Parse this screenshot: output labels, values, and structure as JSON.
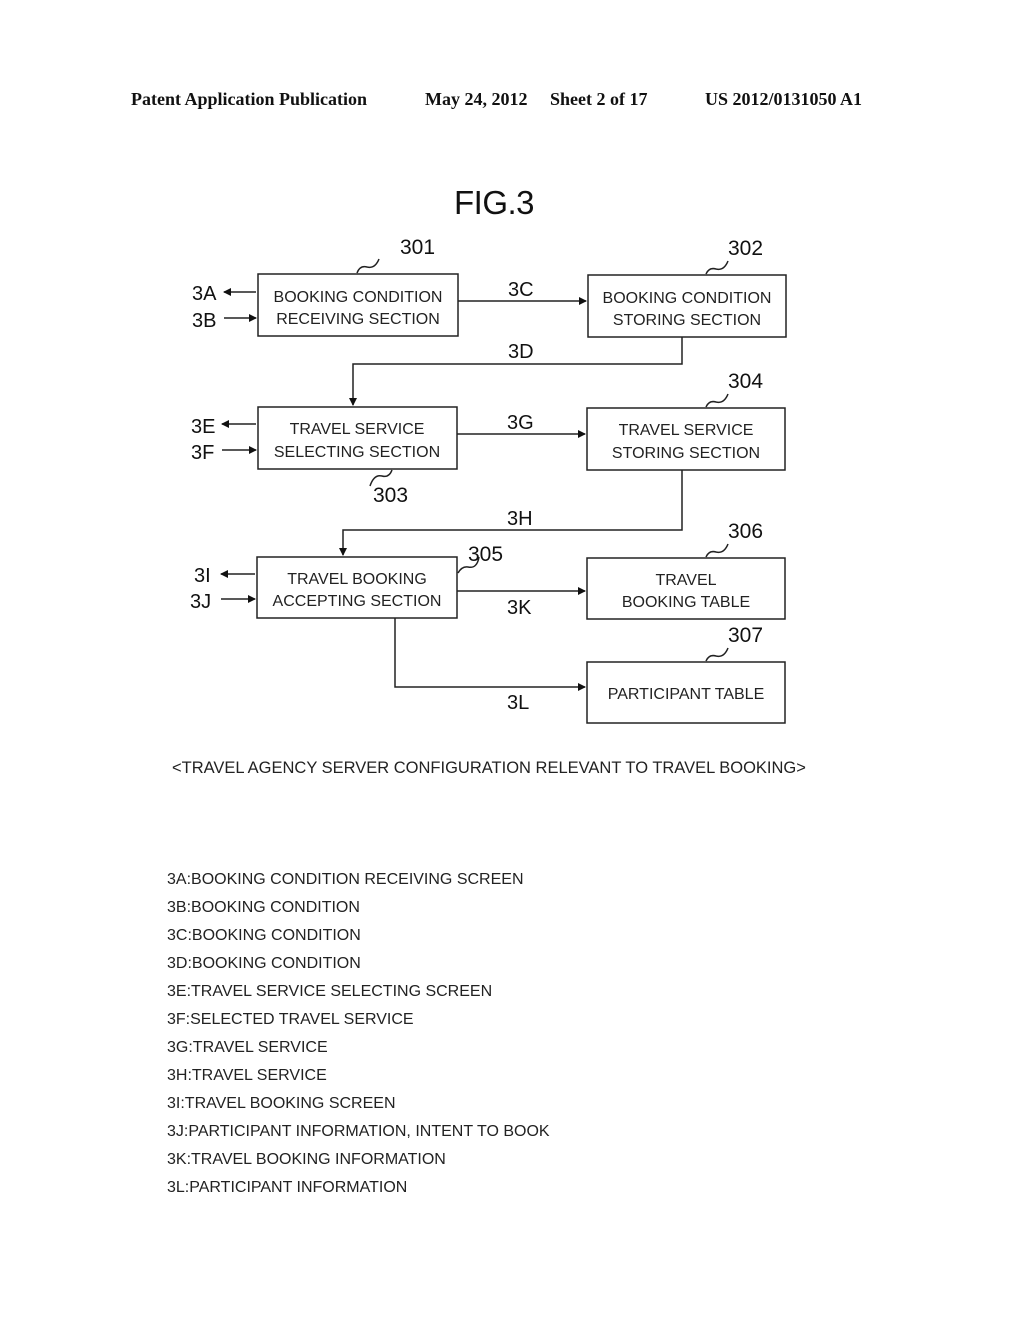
{
  "header": {
    "publication": "Patent Application Publication",
    "date": "May 24, 2012",
    "sheet": "Sheet 2 of 17",
    "number": "US 2012/0131050 A1"
  },
  "figure": {
    "title": "FIG.3",
    "caption": "<TRAVEL AGENCY SERVER CONFIGURATION RELEVANT TO TRAVEL BOOKING>",
    "boxes": [
      {
        "ref": "301",
        "line1": "BOOKING CONDITION",
        "line2": "RECEIVING SECTION"
      },
      {
        "ref": "302",
        "line1": "BOOKING CONDITION",
        "line2": "STORING SECTION"
      },
      {
        "ref": "303",
        "line1": "TRAVEL SERVICE",
        "line2": "SELECTING SECTION"
      },
      {
        "ref": "304",
        "line1": "TRAVEL SERVICE",
        "line2": "STORING SECTION"
      },
      {
        "ref": "305",
        "line1": "TRAVEL BOOKING",
        "line2": "ACCEPTING SECTION"
      },
      {
        "ref": "306",
        "line1": "TRAVEL",
        "line2": "BOOKING TABLE"
      },
      {
        "ref": "307",
        "line1": "PARTICIPANT TABLE",
        "line2": ""
      }
    ],
    "signals": {
      "3A": "3A",
      "3B": "3B",
      "3C": "3C",
      "3D": "3D",
      "3E": "3E",
      "3F": "3F",
      "3G": "3G",
      "3H": "3H",
      "3I": "3I",
      "3J": "3J",
      "3K": "3K",
      "3L": "3L"
    }
  },
  "legend": [
    "3A:BOOKING CONDITION RECEIVING SCREEN",
    "3B:BOOKING CONDITION",
    "3C:BOOKING CONDITION",
    "3D:BOOKING CONDITION",
    "3E:TRAVEL SERVICE SELECTING SCREEN",
    "3F:SELECTED TRAVEL SERVICE",
    "3G:TRAVEL SERVICE",
    "3H:TRAVEL SERVICE",
    "3I:TRAVEL BOOKING SCREEN",
    "3J:PARTICIPANT INFORMATION, INTENT TO BOOK",
    "3K:TRAVEL BOOKING INFORMATION",
    "3L:PARTICIPANT INFORMATION"
  ]
}
